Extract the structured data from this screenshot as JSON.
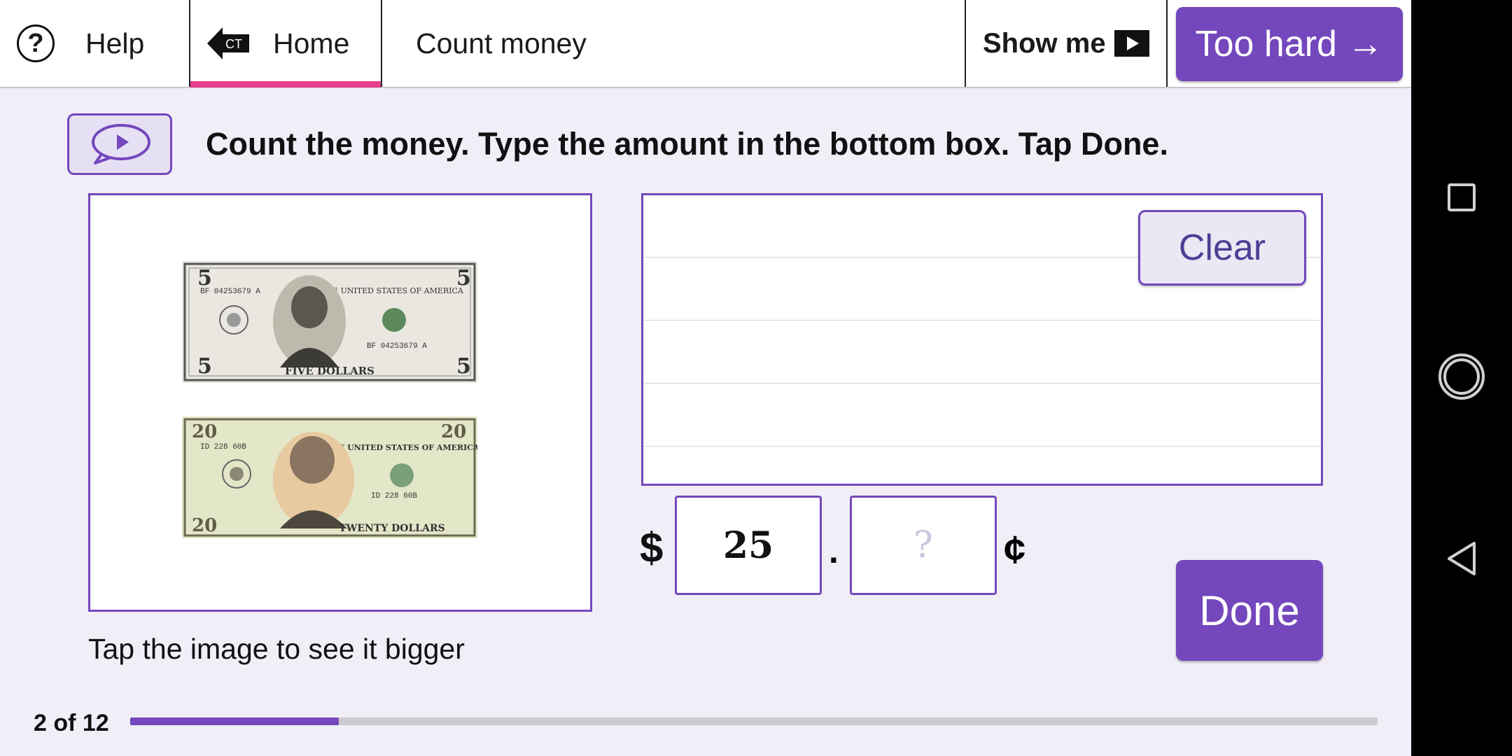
{
  "topbar": {
    "help_icon": "?",
    "help_label": "Help",
    "home_badge": "CT",
    "home_label": "Home",
    "activity_title": "Count money",
    "show_me_label": "Show me",
    "too_hard_label": "Too hard →"
  },
  "instruction": "Count the money. Type the amount in the bottom box. Tap Done.",
  "money": {
    "bills": [
      {
        "denomination": "5",
        "serial": "BF 04253679 A",
        "banner": "THE UNITED STATES OF AMERICA",
        "words": "FIVE DOLLARS"
      },
      {
        "denomination": "20",
        "serial": "ID 228 60B",
        "banner": "THE UNITED STATES OF AMERICA",
        "words": "TWENTY DOLLARS"
      }
    ],
    "hint": "Tap the image to see it bigger"
  },
  "scratch": {
    "clear_label": "Clear"
  },
  "answer": {
    "dollar_sign": "$",
    "dollars_value": "25",
    "separator": ".",
    "cents_placeholder": "?",
    "cent_sign": "¢"
  },
  "done_label": "Done",
  "progress": {
    "label": "2 of 12",
    "current": 2,
    "total": 12,
    "fraction": 0.167
  },
  "colors": {
    "accent": "#7447bc",
    "underline": "#ea3f8c",
    "background": "#f1eef8"
  },
  "android_nav": [
    "recents-icon",
    "home-icon",
    "back-icon"
  ]
}
